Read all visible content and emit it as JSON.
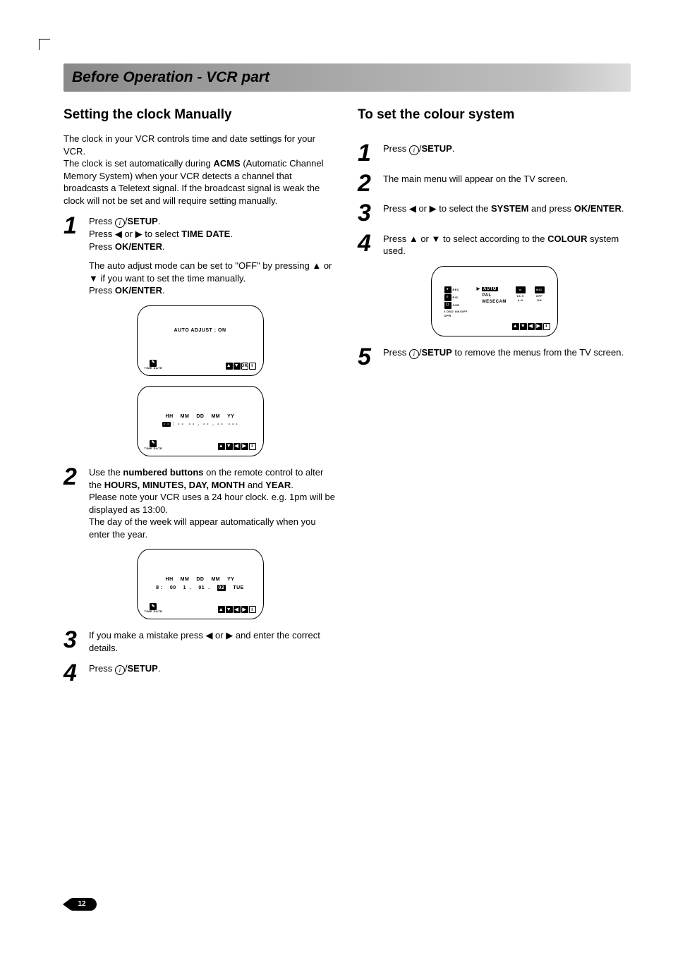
{
  "heading": "Before Operation - VCR part",
  "left": {
    "title": "Setting the clock Manually",
    "intro_part1": "The clock in your VCR controls time and date settings for your VCR.",
    "intro_part2a": "The clock is set automatically during ",
    "intro_acms": "ACMS",
    "intro_part2b": " (Automatic Channel Memory System) when your VCR detects a channel that broadcasts a Teletext signal. If the broadcast signal is weak the clock will not be set and will require setting manually.",
    "step1_l1a": "Press ",
    "step1_l1b": "/",
    "step1_l1_setup": "SETUP",
    "step1_l1c": ".",
    "step1_l2a": "Press ◀ or ▶ to select ",
    "step1_l2_timedate": "TIME DATE",
    "step1_l2b": ".",
    "step1_l3a": "Press ",
    "step1_l3_ok": "OK/ENTER",
    "step1_l3b": ".",
    "step1_note1": "The auto adjust mode can be set to \"OFF\" by pressing ▲ or ▼ if you want to set the time manually.",
    "step1_note2a": "Press ",
    "step1_note2_ok": "OK/ENTER",
    "step1_note2b": ".",
    "tv1_text": "AUTO   ADJUST  :  ON",
    "tv1_icon_label": "TIME DATE",
    "tv2_head": {
      "hh": "HH",
      "mm": "MM",
      "dd": "DD",
      "mm2": "MM",
      "yy": "YY"
    },
    "tv2_row": "- -  :  - -     - -  .  - -  .  - -    - - -",
    "step2_a": "Use the ",
    "step2_numbered": "numbered buttons",
    "step2_b": " on the remote control to alter the ",
    "step2_fields": "HOURS, MINUTES, DAY, MONTH",
    "step2_c": " and ",
    "step2_year": "YEAR",
    "step2_d": ".",
    "step2_note1": "Please note your VCR uses a 24 hour clock. e.g. 1pm will be displayed as 13:00.",
    "step2_note2": "The day of the week will appear automatically when you enter the year.",
    "tv3_head": {
      "hh": "HH",
      "mm": "MM",
      "dd": "DD",
      "mm2": "MM",
      "yy": "YY"
    },
    "tv3_row": {
      "hh": "8",
      "mm": "00",
      "dd": "1",
      "mm2": "01",
      "yy": "02",
      "day": "TUE"
    },
    "step3": "If you make a mistake  press ◀ or ▶ and enter the correct details.",
    "step4_a": "Press ",
    "step4_b": "/",
    "step4_setup": "SETUP",
    "step4_c": "."
  },
  "right": {
    "title": "To set the colour system",
    "step1_a": "Press ",
    "step1_b": "/",
    "step1_setup": "SETUP",
    "step1_c": ".",
    "step2": "The main menu will appear on the TV screen.",
    "step3_a": "Press ◀ or ▶ to select the ",
    "step3_system": "SYSTEM",
    "step3_b": " and press ",
    "step3_ok": "OK/ENTER",
    "step3_c": ".",
    "step4_a": "Press ▲ or ▼ to select according to the ",
    "step4_colour": "COLOUR",
    "step4_b": " system used.",
    "tv_menu": {
      "col1": [
        "REC",
        "P/S",
        "OSD",
        "f.OSD ON/OFF",
        "OPR"
      ],
      "col2_marker": "▶",
      "col2": [
        "AUTO",
        "PAL",
        "MESECAM"
      ],
      "col3_icon": "16:9 4:3",
      "col3_labels": [
        "16:9",
        "4:3"
      ],
      "col4_icon": "NIC",
      "col4_labels": [
        "OFF",
        "ON"
      ]
    },
    "step5_a": "Press ",
    "step5_b": "/",
    "step5_setup": "SETUP",
    "step5_c": " to remove the menus from the TV screen."
  },
  "nav_keys": {
    "up": "▲",
    "down": "▼",
    "left": "◀",
    "right": "▶",
    "ok": "i"
  },
  "page_number": "12"
}
